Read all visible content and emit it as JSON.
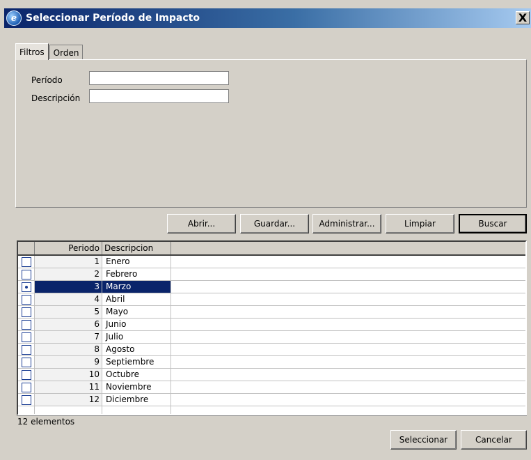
{
  "window": {
    "title": "Seleccionar Período de Impacto",
    "close_label": "X"
  },
  "tabs": [
    {
      "label": "Filtros",
      "active": true
    },
    {
      "label": "Orden",
      "active": false
    }
  ],
  "filters": {
    "periodo": {
      "label": "Período",
      "value": ""
    },
    "descripcion": {
      "label": "Descripción",
      "value": ""
    }
  },
  "toolbar": {
    "abrir": "Abrir...",
    "guardar": "Guardar...",
    "administrar": "Administrar...",
    "limpiar": "Limpiar",
    "buscar": "Buscar"
  },
  "table": {
    "columns": [
      "Periodo",
      "Descripcion"
    ],
    "rows": [
      {
        "periodo": "1",
        "descripcion": "Enero"
      },
      {
        "periodo": "2",
        "descripcion": "Febrero"
      },
      {
        "periodo": "3",
        "descripcion": "Marzo",
        "selected": true
      },
      {
        "periodo": "4",
        "descripcion": "Abril"
      },
      {
        "periodo": "5",
        "descripcion": "Mayo"
      },
      {
        "periodo": "6",
        "descripcion": "Junio"
      },
      {
        "periodo": "7",
        "descripcion": "Julio"
      },
      {
        "periodo": "8",
        "descripcion": "Agosto"
      },
      {
        "periodo": "9",
        "descripcion": "Septiembre"
      },
      {
        "periodo": "10",
        "descripcion": "Octubre"
      },
      {
        "periodo": "11",
        "descripcion": "Noviembre"
      },
      {
        "periodo": "12",
        "descripcion": "Diciembre"
      }
    ]
  },
  "status": {
    "count_text": "12 elementos"
  },
  "actions": {
    "seleccionar": "Seleccionar",
    "cancelar": "Cancelar"
  },
  "colors": {
    "title_start": "#0a246a",
    "selection": "#0a246a",
    "face": "#d4d0c8"
  }
}
